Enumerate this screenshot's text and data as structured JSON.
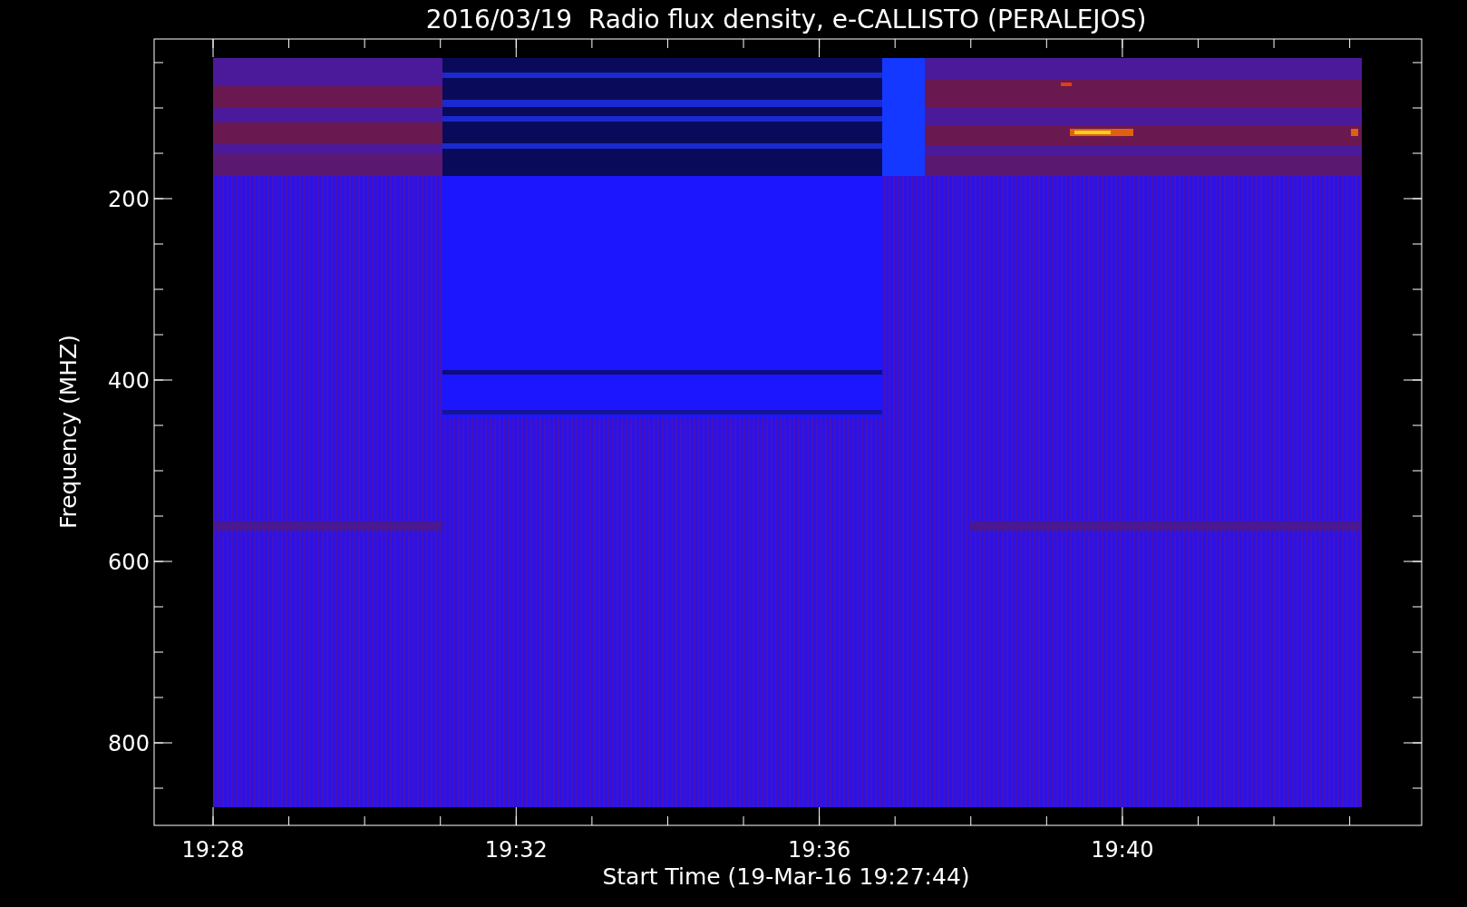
{
  "plot": {
    "title": "2016/03/19  Radio flux density, e-CALLISTO (PERALEJOS)",
    "y_axis": {
      "label": "Frequency (MHZ)",
      "ticks": [
        "200",
        "400",
        "600",
        "800"
      ]
    },
    "x_axis": {
      "label": "Start Time (19-Mar-16 19:27:44)",
      "ticks": [
        "19:28",
        "19:32",
        "19:36",
        "19:40"
      ]
    }
  }
}
